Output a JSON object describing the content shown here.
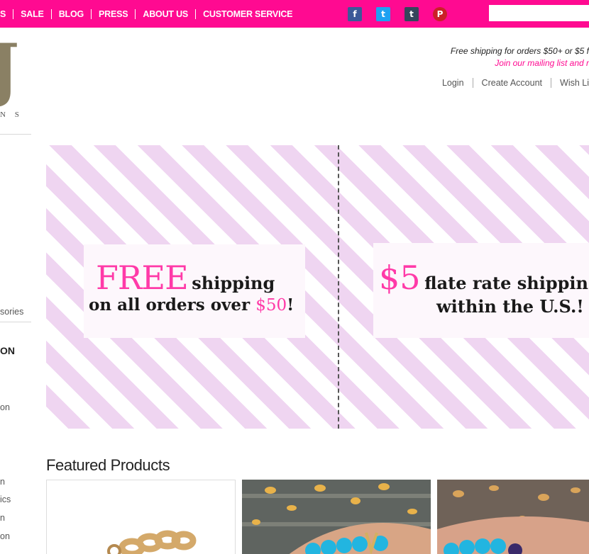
{
  "nav": {
    "items": [
      "S",
      "SALE",
      "BLOG",
      "PRESS",
      "ABOUT US",
      "CUSTOMER SERVICE"
    ]
  },
  "social": {
    "facebook": "f",
    "twitter": "t",
    "tumblr": "t",
    "pinterest": "P"
  },
  "search": {
    "placeholder": ""
  },
  "logo": {
    "letter": "J",
    "sub": "N S"
  },
  "header": {
    "shipping_note": "Free shipping for orders $50+ or $5 f",
    "mailing_note": "Join our mailing list and r",
    "account_links": [
      "Login",
      "Create Account",
      "Wish Li"
    ]
  },
  "sidebar": {
    "category_fragment": "sories",
    "heading_fragment": "ON",
    "items": [
      "on",
      "n",
      "ics",
      "n",
      "on"
    ]
  },
  "banner": {
    "left": {
      "word1": "FREE",
      "word2": "shipping",
      "line2a": "on all orders over",
      "amount": "$50",
      "line2b": "!"
    },
    "right": {
      "amount": "$5",
      "line1": "flate rate shipping",
      "line2": "within the U.S.!"
    }
  },
  "featured": {
    "title": "Featured Products"
  },
  "colors": {
    "brand_pink": "#ff0a91",
    "stripe": "#efd5f1",
    "accent_pink": "#ff3aa8"
  }
}
